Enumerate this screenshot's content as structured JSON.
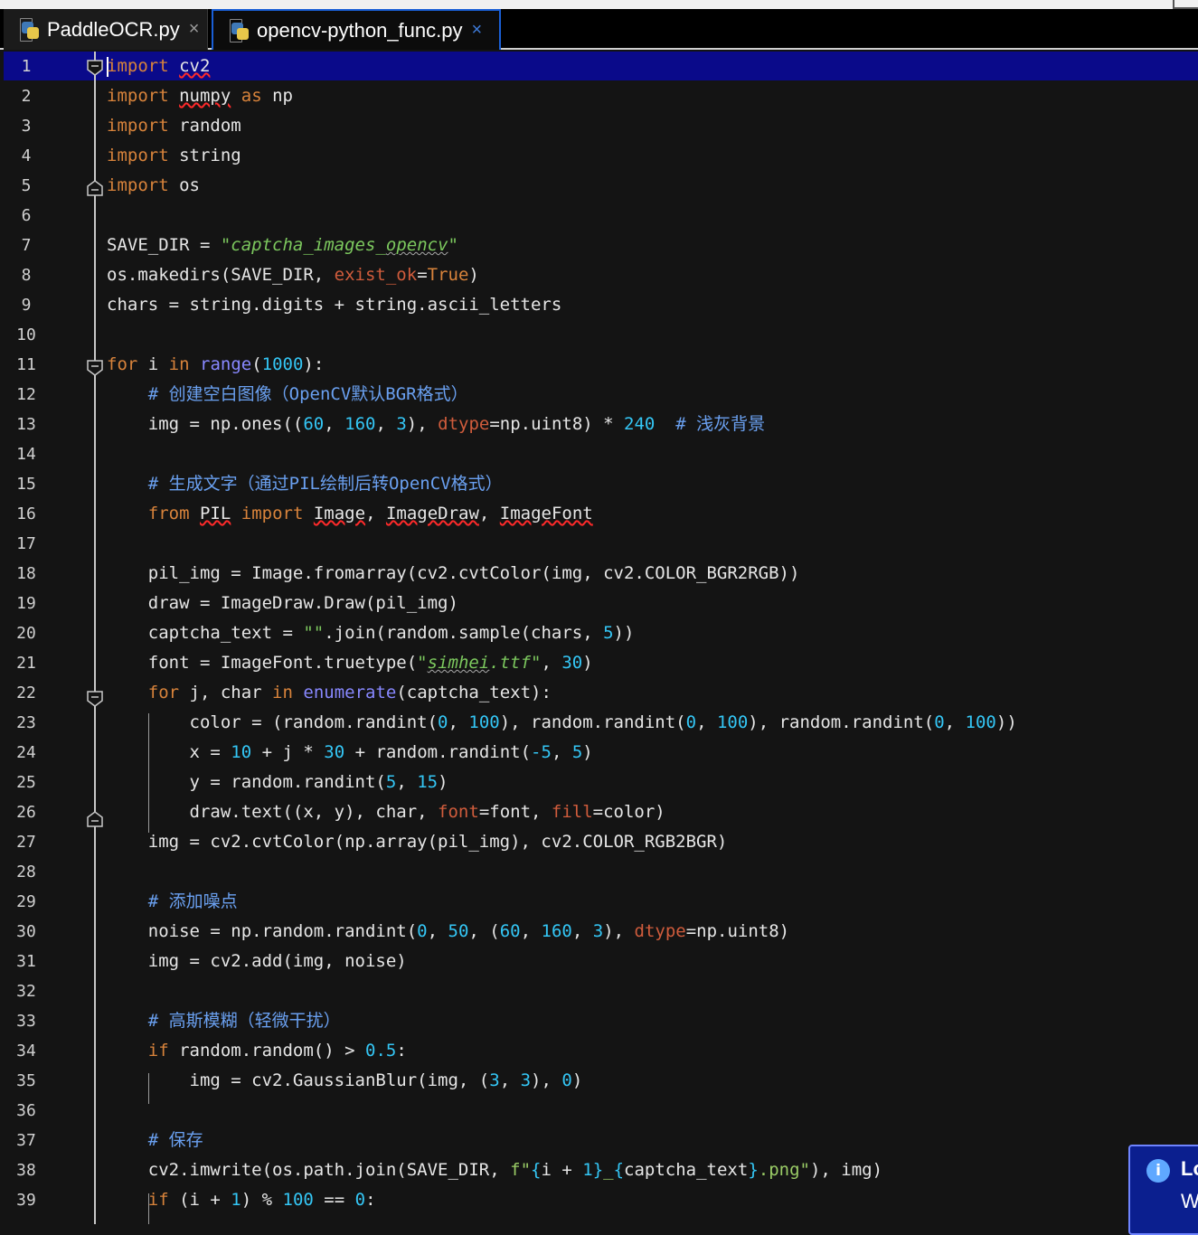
{
  "tabs": [
    {
      "label": "PaddleOCR.py",
      "close": "×",
      "icon": "python-file-icon"
    },
    {
      "label": "opencv-python_func.py",
      "close": "×",
      "icon": "python-file-icon",
      "active": true
    }
  ],
  "editor": {
    "current_line": 1,
    "lines": [
      {
        "n": "1"
      },
      {
        "n": "2"
      },
      {
        "n": "3"
      },
      {
        "n": "4"
      },
      {
        "n": "5"
      },
      {
        "n": "6"
      },
      {
        "n": "7"
      },
      {
        "n": "8"
      },
      {
        "n": "9"
      },
      {
        "n": "10"
      },
      {
        "n": "11"
      },
      {
        "n": "12"
      },
      {
        "n": "13"
      },
      {
        "n": "14"
      },
      {
        "n": "15"
      },
      {
        "n": "16"
      },
      {
        "n": "17"
      },
      {
        "n": "18"
      },
      {
        "n": "19"
      },
      {
        "n": "20"
      },
      {
        "n": "21"
      },
      {
        "n": "22"
      },
      {
        "n": "23"
      },
      {
        "n": "24"
      },
      {
        "n": "25"
      },
      {
        "n": "26"
      },
      {
        "n": "27"
      },
      {
        "n": "28"
      },
      {
        "n": "29"
      },
      {
        "n": "30"
      },
      {
        "n": "31"
      },
      {
        "n": "32"
      },
      {
        "n": "33"
      },
      {
        "n": "34"
      },
      {
        "n": "35"
      },
      {
        "n": "36"
      },
      {
        "n": "37"
      },
      {
        "n": "38"
      },
      {
        "n": "39"
      }
    ],
    "code": {
      "l1": {
        "a": "import",
        "b": " ",
        "c": "cv2"
      },
      "l2": {
        "a": "import",
        "b": " ",
        "c": "numpy",
        "d": " ",
        "e": "as",
        "f": " np"
      },
      "l3": {
        "a": "import",
        "b": " random"
      },
      "l4": {
        "a": "import",
        "b": " string"
      },
      "l5": {
        "a": "import",
        "b": " os"
      },
      "l7": {
        "a": "SAVE_DIR = ",
        "b": "\"captcha_images_",
        "c": "opencv",
        "d": "\""
      },
      "l8": {
        "a": "os.makedirs(SAVE_DIR, ",
        "b": "exist_ok",
        "c": "=",
        "d": "True",
        "e": ")"
      },
      "l9": {
        "a": "chars = string.digits + string.ascii_letters"
      },
      "l11": {
        "a": "for",
        "b": " i ",
        "c": "in",
        "d": " ",
        "e": "range",
        "f": "(",
        "g": "1000",
        "h": "):"
      },
      "l12": {
        "a": "    ",
        "b": "# 创建空白图像（OpenCV默认BGR格式）"
      },
      "l13": {
        "a": "    img = np.ones((",
        "b": "60",
        "c": ", ",
        "d": "160",
        "e": ", ",
        "f": "3",
        "g": "), ",
        "h": "dtype",
        "i": "=np.uint8) * ",
        "j": "240",
        "k": "  ",
        "l": "# 浅灰背景"
      },
      "l15": {
        "a": "    ",
        "b": "# 生成文字（通过PIL绘制后转OpenCV格式）"
      },
      "l16": {
        "a": "    ",
        "b": "from",
        "c": " ",
        "d": "PIL",
        "e": " ",
        "f": "import",
        "g": " ",
        "h": "Image",
        "i": ", ",
        "j": "ImageDraw",
        "k": ", ",
        "l": "ImageFont"
      },
      "l18": {
        "a": "    pil_img = Image.fromarray(cv2.cvtColor(img, cv2.COLOR_BGR2RGB))"
      },
      "l19": {
        "a": "    draw = ImageDraw.Draw(pil_img)"
      },
      "l20": {
        "a": "    captcha_text = ",
        "b": "\"\"",
        "c": ".join(random.sample(chars, ",
        "d": "5",
        "e": "))"
      },
      "l21": {
        "a": "    font = ImageFont.truetype(",
        "b": "\"",
        "c": "simhei",
        "d": ".ttf\"",
        "e": ", ",
        "f": "30",
        "g": ")"
      },
      "l22": {
        "a": "    ",
        "b": "for",
        "c": " j, char ",
        "d": "in",
        "e": " ",
        "f": "enumerate",
        "g": "(captcha_text):"
      },
      "l23": {
        "a": "        color = (random.randint(",
        "b": "0",
        "c": ", ",
        "d": "100",
        "e": "), random.randint(",
        "f": "0",
        "g": ", ",
        "h": "100",
        "i": "), random.randint(",
        "j": "0",
        "k": ", ",
        "l": "100",
        "m": "))"
      },
      "l24": {
        "a": "        x = ",
        "b": "10",
        "c": " + j * ",
        "d": "30",
        "e": " + random.randint(",
        "f": "-5",
        "g": ", ",
        "h": "5",
        "i": ")"
      },
      "l25": {
        "a": "        y = random.randint(",
        "b": "5",
        "c": ", ",
        "d": "15",
        "e": ")"
      },
      "l26": {
        "a": "        draw.text((x, y), char, ",
        "b": "font",
        "c": "=font, ",
        "d": "fill",
        "e": "=color)"
      },
      "l27": {
        "a": "    img = cv2.cvtColor(np.array(pil_img), cv2.COLOR_RGB2BGR)"
      },
      "l29": {
        "a": "    ",
        "b": "# 添加噪点"
      },
      "l30": {
        "a": "    noise = np.random.randint(",
        "b": "0",
        "c": ", ",
        "d": "50",
        "e": ", (",
        "f": "60",
        "g": ", ",
        "h": "160",
        "i": ", ",
        "j": "3",
        "k": "), ",
        "l": "dtype",
        "m": "=np.uint8)"
      },
      "l31": {
        "a": "    img = cv2.add(img, noise)"
      },
      "l33": {
        "a": "    ",
        "b": "# 高斯模糊（轻微干扰）"
      },
      "l34": {
        "a": "    ",
        "b": "if",
        "c": " random.random() > ",
        "d": "0.5",
        "e": ":"
      },
      "l35": {
        "a": "        img = cv2.GaussianBlur(img, (",
        "b": "3",
        "c": ", ",
        "d": "3",
        "e": "), ",
        "f": "0",
        "g": ")"
      },
      "l37": {
        "a": "    ",
        "b": "# 保存"
      },
      "l38": {
        "a": "    cv2.imwrite(os.path.join(SAVE_DIR, ",
        "b": "f\"",
        "c": "{",
        "d": "i + ",
        "e": "1",
        "f": "}",
        "g": "_",
        "h": "{",
        "i": "captcha_text",
        "j": "}",
        "k": ".png\"",
        "l": "), img)"
      },
      "l39": {
        "a": "    ",
        "b": "if",
        "c": " (i + ",
        "d": "1",
        "e": ") % ",
        "f": "100",
        "g": " == ",
        "h": "0",
        "i": ":"
      }
    }
  },
  "notification": {
    "icon": "info-icon",
    "icon_glyph": "i",
    "title": "Lo",
    "body": "W"
  },
  "colors": {
    "background": "#141414",
    "current_line": "#0a0a8a",
    "keyword": "#d8833b",
    "number": "#34c6f5",
    "string": "#7cc85e",
    "comment": "#6aa0f0",
    "tab_active_border": "#1a5fd6"
  }
}
